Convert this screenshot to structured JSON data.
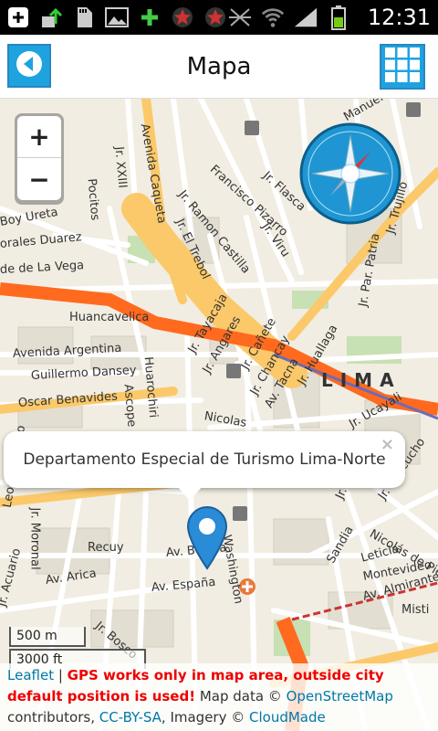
{
  "status_bar": {
    "time": "12:31",
    "left_icons": [
      "add-box-icon",
      "upload-icon",
      "sd-card-icon",
      "image-icon",
      "plus-icon",
      "star-icon",
      "star-icon"
    ],
    "right_icons": [
      "mute-icon",
      "wifi-icon",
      "signal-icon",
      "battery-icon"
    ]
  },
  "header": {
    "title": "Mapa"
  },
  "map": {
    "zoom_in": "+",
    "zoom_out": "−",
    "city_label": "LIMA",
    "streets": [
      "Avenida Caqueta",
      "Jr. XXIII",
      "Pocitos",
      "Boy Ureta",
      "orales Duarez",
      "de de La Vega",
      "Jr. Ramon Castilla",
      "Jr. El Trebol",
      "Francisco Pizarro",
      "Jr. Flasca",
      "Jr. Viru",
      "Manuel Alcazar",
      "Jr. Trujillo",
      "Huancavelica",
      "Avenida Argentina",
      "Guillermo Dansey",
      "Oscar Benavides",
      "Jr. Tayacaja",
      "Jr. Angares",
      "Jr. Cañete",
      "Jr. Chancay",
      "Jr. Huallaga",
      "Av. Tacna",
      "Jr. Ucayali",
      "Huarochiri",
      "Ascope",
      "Nicolas",
      "Jr. Ayacucho",
      "Jr. Par. Patria",
      "Leoncio Prado",
      "Jr. Moronal",
      "Recuy",
      "Av. Bolivia",
      "Washington",
      "Av. Arica",
      "Av. España",
      "Jr. Lampa",
      "Sandia",
      "Leticia",
      "Montevideo",
      "Nicolás de Piérola",
      "Av. Almirante",
      "Misti",
      "Jr. Acuario",
      "Jr. Bosco"
    ],
    "popup_text": "Departamento Especial de Turismo Lima-Norte",
    "popup_close": "×",
    "scale_metric": "500 m",
    "scale_imperial": "3000 ft"
  },
  "attribution": {
    "leaflet": "Leaflet",
    "separator": " | ",
    "warning": "GPS works only in map area, outside city default position is used!",
    "map_data": " Map data © ",
    "osm": "OpenStreetMap",
    "contributors": " contributors, ",
    "license": "CC-BY-SA",
    "imagery": ", Imagery © ",
    "cloudmade": "CloudMade"
  },
  "colors": {
    "accent": "#1ea3df",
    "motorway": "#ff6a1f",
    "primary_road": "#fbc96a",
    "marker": "#2a8bd7",
    "warning": "#e00000",
    "link": "#0078a8"
  }
}
